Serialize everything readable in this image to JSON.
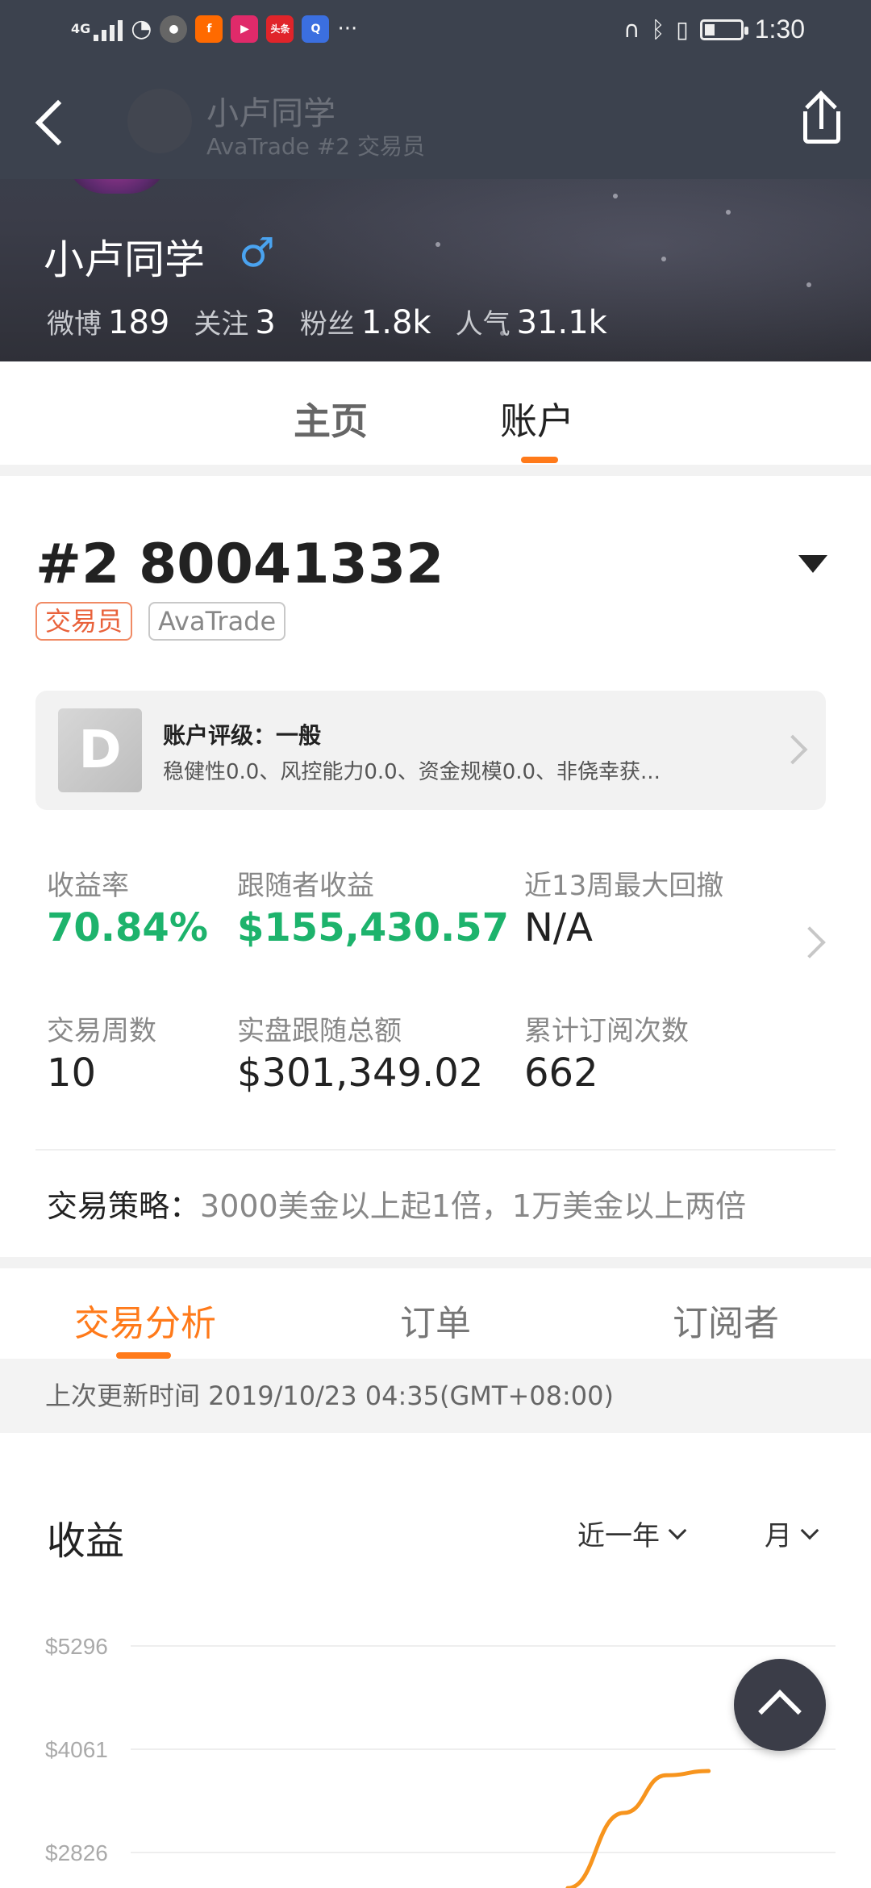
{
  "status_bar": {
    "network": "4G",
    "app_badge_toutiao": "头条",
    "more": "···",
    "time": "1:30"
  },
  "nav": {
    "title": "小卢同学",
    "subtitle": "AvaTrade #2 交易员"
  },
  "profile": {
    "name": "小卢同学",
    "gender_symbol": "♂",
    "stats": [
      {
        "label": "微博",
        "value": "189"
      },
      {
        "label": "关注",
        "value": "3"
      },
      {
        "label": "粉丝",
        "value": "1.8k"
      },
      {
        "label": "人气",
        "value": "31.1k"
      }
    ]
  },
  "top_tabs": {
    "home": "主页",
    "account": "账户",
    "active": "账户"
  },
  "account": {
    "id": "#2 80041332",
    "tags": {
      "role": "交易员",
      "broker": "AvaTrade"
    },
    "rating": {
      "grade": "D",
      "title": "账户评级：一般",
      "desc": "稳健性0.0、风控能力0.0、资金规模0.0、非侥幸获..."
    },
    "metrics": {
      "return_rate": {
        "label": "收益率",
        "value": "70.84%"
      },
      "follower_profit": {
        "label": "跟随者收益",
        "value": "$155,430.57"
      },
      "max_drawdown": {
        "label": "近13周最大回撤",
        "value": "N/A"
      },
      "trade_weeks": {
        "label": "交易周数",
        "value": "10"
      },
      "live_follow_total": {
        "label": "实盘跟随总额",
        "value": "$301,349.02"
      },
      "subscriptions": {
        "label": "累计订阅次数",
        "value": "662"
      }
    },
    "strategy": {
      "label": "交易策略：",
      "text": "3000美金以上起1倍，1万美金以上两倍"
    }
  },
  "sub_tabs": {
    "analysis": "交易分析",
    "orders": "订单",
    "subscribers": "订阅者",
    "active": "交易分析"
  },
  "update": {
    "text": "上次更新时间 2019/10/23 04:35(GMT+08:00)"
  },
  "earnings": {
    "title": "收益",
    "range_filter": "近一年",
    "unit_filter": "月"
  },
  "colors": {
    "accent": "#ff7a1a",
    "positive": "#1db36c",
    "header_bg": "#3c424e",
    "line": "#f7941d"
  },
  "chart_data": {
    "type": "line",
    "title": "收益",
    "yticks": [
      "$5296",
      "$4061",
      "$2826"
    ],
    "ylim": [
      2826,
      5296
    ],
    "grid": true,
    "series": [
      {
        "values": [
          {
            "x": 0.62,
            "y": 2400
          },
          {
            "x": 0.7,
            "y": 3300
          },
          {
            "x": 0.76,
            "y": 3750
          },
          {
            "x": 0.82,
            "y": 3800
          }
        ]
      }
    ]
  }
}
